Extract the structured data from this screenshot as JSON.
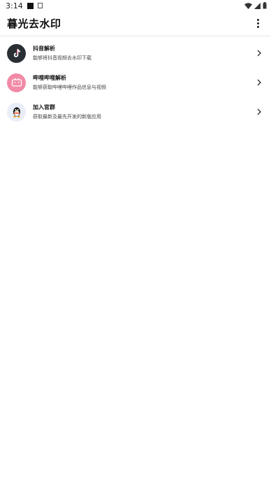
{
  "status": {
    "time": "3:14"
  },
  "app": {
    "title": "暮光去水印"
  },
  "items": [
    {
      "title": "抖音解析",
      "subtitle": "能够将抖音视频去水印下载",
      "icon": "tiktok-icon",
      "color": "#2a2f36"
    },
    {
      "title": "哔哩哔哩解析",
      "subtitle": "能够获取哔哩哔哩作品信息与视频",
      "icon": "bilibili-icon",
      "color": "#f28aa6"
    },
    {
      "title": "加入官群",
      "subtitle": "获取最新及最先开发的新版应用",
      "icon": "qq-icon",
      "color": "#e9eef8"
    }
  ],
  "colors": {
    "accent": "#111111",
    "divider": "#e6e6e6"
  }
}
